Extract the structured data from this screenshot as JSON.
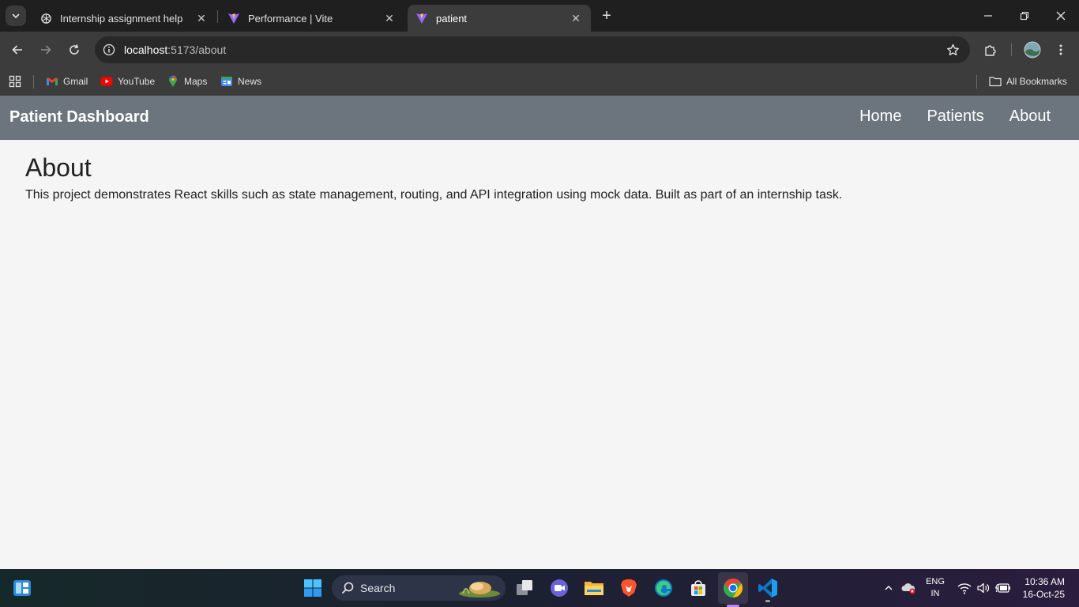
{
  "browser": {
    "tabs": [
      {
        "title": "Internship assignment help",
        "favicon": "chatgpt-icon",
        "active": false
      },
      {
        "title": "Performance | Vite",
        "favicon": "vite-icon",
        "active": false
      },
      {
        "title": "patient",
        "favicon": "vite-icon",
        "active": true
      }
    ],
    "address": {
      "host": "localhost",
      "path": ":5173/about"
    },
    "bookmarks": [
      {
        "label": "Gmail",
        "icon": "gmail-icon"
      },
      {
        "label": "YouTube",
        "icon": "youtube-icon"
      },
      {
        "label": "Maps",
        "icon": "maps-icon"
      },
      {
        "label": "News",
        "icon": "news-icon"
      }
    ],
    "all_bookmarks_label": "All Bookmarks"
  },
  "page": {
    "brand": "Patient Dashboard",
    "nav": [
      "Home",
      "Patients",
      "About"
    ],
    "heading": "About",
    "description": "This project demonstrates React skills such as state management, routing, and API integration using mock data. Built as part of an internship task."
  },
  "taskbar": {
    "search_placeholder": "Search",
    "language": {
      "line1": "ENG",
      "line2": "IN"
    },
    "time": "10:36 AM",
    "date": "16-Oct-25"
  },
  "colors": {
    "navbar": "#6c757d",
    "page_bg": "#f5f5f5",
    "tabstrip": "#1f1f1f",
    "toolbar": "#3c3c3c"
  }
}
